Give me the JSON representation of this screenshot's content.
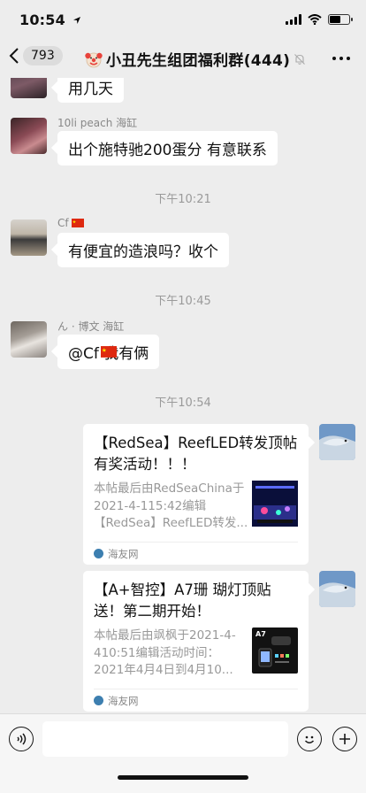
{
  "status": {
    "time": "10:54"
  },
  "nav": {
    "unread_count": "793",
    "title": "小丑先生组团福利群(444)"
  },
  "messages": [
    {
      "text": "用几天"
    },
    {
      "sender": "10li peach 海缸",
      "text": "出个施特驰200蛋分  有意联系"
    },
    {
      "sender": "Cf",
      "text": "有便宜的造浪吗？收个"
    },
    {
      "sender": "ん · 博文 海缸",
      "text": "@Cf  我有俩"
    }
  ],
  "timestamps": [
    "下午10:21",
    "下午10:45",
    "下午10:54"
  ],
  "cards": [
    {
      "title": "【RedSea】ReefLED转发顶帖有奖活动！！！",
      "desc": "本帖最后由RedSeaChina于2021-4-115:42编辑【RedSea】ReefLED转发...",
      "source": "海友网"
    },
    {
      "title": "【A+智控】A7珊 瑚灯顶贴送！第二期开始！",
      "desc": "本帖最后由飒枫于2021-4-410:51编辑活动时间：2021年4月4日到4月10...",
      "thumb_label": "A7",
      "source": "海友网"
    }
  ],
  "colors": {
    "background": "#ededed",
    "bubble": "#ffffff",
    "timestamp_text": "#9a9a9a",
    "meta_text": "#888888"
  },
  "icons": {
    "back": "chevron-left-icon",
    "title_emoji": "clown-face-icon",
    "mute": "bell-slash-icon",
    "more": "more-dots-icon",
    "flag": "china-flag-icon",
    "voice": "voice-icon",
    "emoji": "emoji-icon",
    "plus": "plus-icon"
  }
}
